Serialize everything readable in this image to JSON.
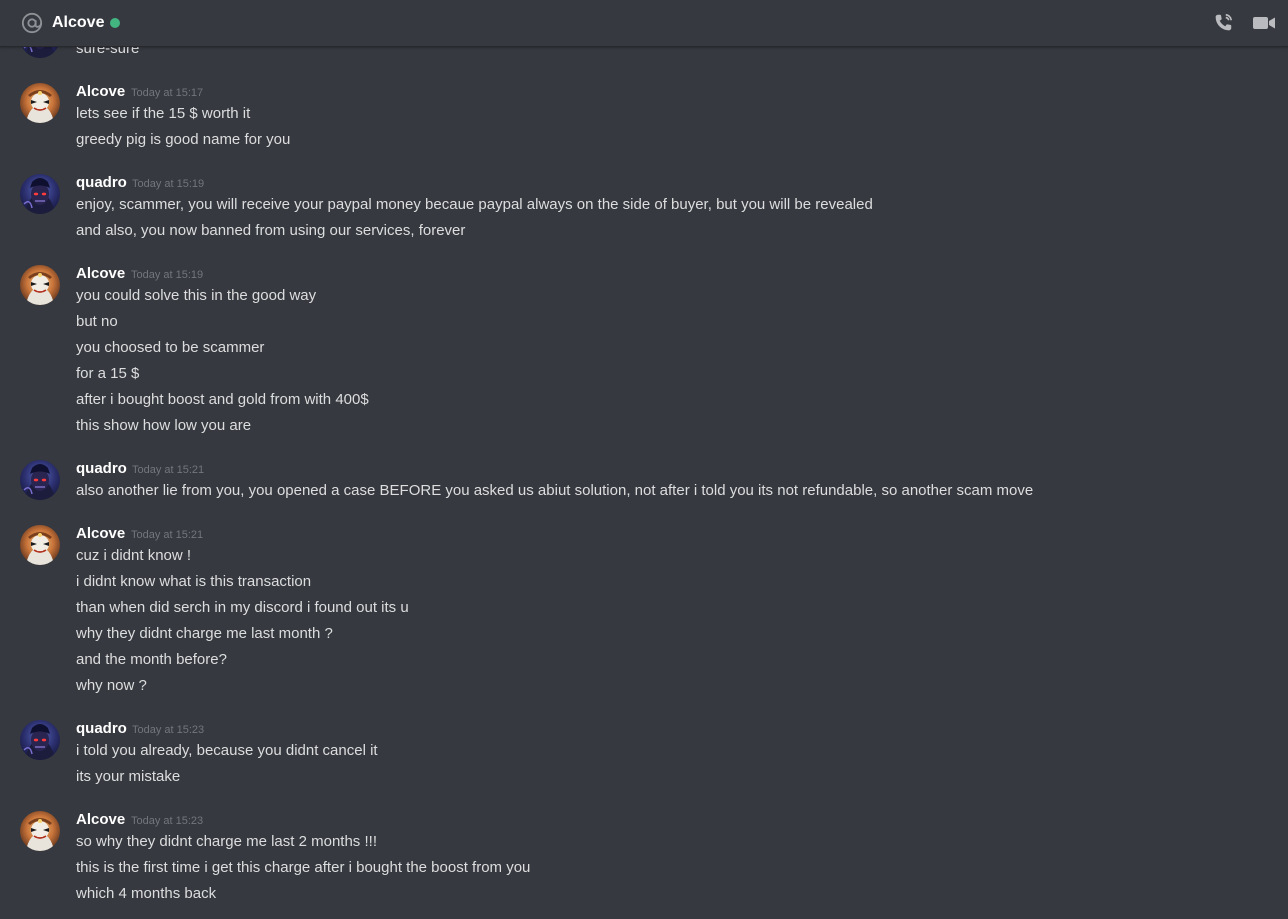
{
  "header": {
    "channel_name": "Alcove",
    "status": "online",
    "status_color": "#43b581",
    "icons": [
      "at-icon",
      "voice-call-icon",
      "video-call-icon"
    ]
  },
  "colors": {
    "background": "#36393f",
    "username": "#ffffff",
    "text": "#dcddde",
    "timestamp": "#72767d"
  },
  "messages": {
    "partial": {
      "text": "sure-sure"
    },
    "groups": [
      {
        "author": "Alcove",
        "time": "Today at 15:17",
        "lines": [
          "lets see if the 15 $ worth it",
          "greedy pig is good name for you"
        ]
      },
      {
        "author": "quadro",
        "time": "Today at 15:19",
        "lines": [
          "enjoy, scammer, you will receive your paypal money becaue paypal always on the side of buyer, but you will be revealed",
          "and also, you now banned from using our services, forever"
        ]
      },
      {
        "author": "Alcove",
        "time": "Today at 15:19",
        "lines": [
          "you could solve this in the good way",
          "but no",
          "you choosed to be scammer",
          "for a 15 $",
          "after i bought boost and gold from with 400$",
          "this show how low you are"
        ]
      },
      {
        "author": "quadro",
        "time": "Today at 15:21",
        "lines": [
          "also another lie from you, you opened a case BEFORE you asked us abiut solution, not after i told you its not refundable, so another scam move"
        ]
      },
      {
        "author": "Alcove",
        "time": "Today at 15:21",
        "lines": [
          "cuz i didnt know !",
          "i didnt know what is this transaction",
          "than when did serch in my discord i found out its u",
          "why they didnt charge me last month ?",
          "and the month before?",
          "why now ?"
        ]
      },
      {
        "author": "quadro",
        "time": "Today at 15:23",
        "lines": [
          "i told you already, because you didnt cancel it",
          "its your mistake"
        ]
      },
      {
        "author": "Alcove",
        "time": "Today at 15:23",
        "lines": [
          "so why they didnt charge me last 2 months !!!",
          "this is the first time i get this charge after i bought the boost from you",
          "which 4 months back"
        ]
      }
    ]
  }
}
